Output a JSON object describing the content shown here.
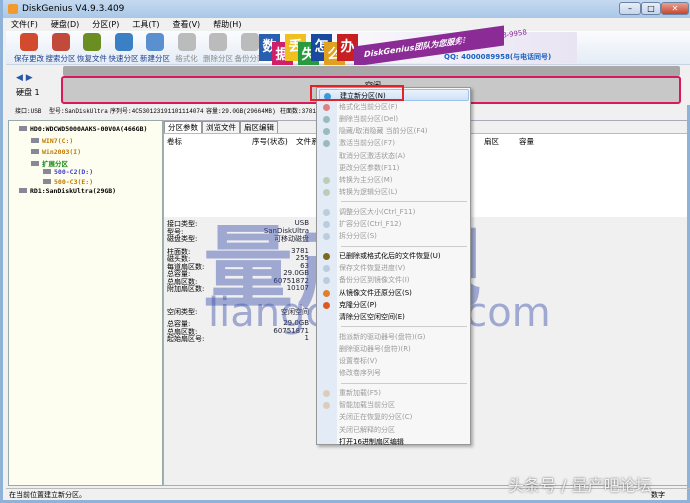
{
  "window": {
    "title": "DiskGenius V4.9.3.409"
  },
  "menubar": [
    "文件(F)",
    "硬盘(D)",
    "分区(P)",
    "工具(T)",
    "查看(V)",
    "帮助(H)"
  ],
  "toolbar": [
    {
      "label": "保存更改",
      "icon": "save-icon",
      "enabled": true,
      "color": "#d24b2e"
    },
    {
      "label": "搜索分区",
      "icon": "search-icon",
      "enabled": true,
      "color": "#c24a3a"
    },
    {
      "label": "恢复文件",
      "icon": "recover-file-icon",
      "enabled": true,
      "color": "#6b8e23"
    },
    {
      "label": "快速分区",
      "icon": "quick-partition-icon",
      "enabled": true,
      "color": "#3b7fc4"
    },
    {
      "label": "新建分区",
      "icon": "new-partition-icon",
      "enabled": true,
      "color": "#5a8fd0"
    },
    {
      "label": "格式化",
      "icon": "format-icon",
      "enabled": false,
      "color": "#bbbbbb"
    },
    {
      "label": "删除分区",
      "icon": "delete-partition-icon",
      "enabled": false,
      "color": "#bbbbbb"
    },
    {
      "label": "备份分区",
      "icon": "backup-partition-icon",
      "enabled": false,
      "color": "#bbbbbb"
    }
  ],
  "banner": {
    "tiles": [
      "数",
      "据",
      "丢",
      "失",
      "怎",
      "么",
      "办"
    ],
    "team": "DiskGenius团队为您服务!",
    "phone": "电话: 400-008-9958",
    "qq": "QQ: 4000089958(与电话同号)"
  },
  "disk_map": {
    "free_label": "空闲",
    "disk_label": "硬盘 1",
    "nav": "◀ ▶"
  },
  "disk_info": {
    "interface": "接口:USB",
    "model": "型号:SanDiskUltra",
    "serial": "序列号:4C530123191101114074",
    "capacity": "容量:29.0GB(29664MB)",
    "cylinders": "柱面数:3781"
  },
  "tree": [
    {
      "label": "HD0:WDCWD5000AAKS-00V0A(466GB)",
      "color": "#000"
    },
    {
      "label": "WIN7(C:)",
      "color": "#c07a00"
    },
    {
      "label": "Win2003(I)",
      "color": "#c07a00"
    },
    {
      "label": "扩展分区",
      "color": "#1a8a1a"
    },
    {
      "label": "500-C2(D:)",
      "color": "#4040d0"
    },
    {
      "label": "500-C3(E:)",
      "color": "#c07a00"
    },
    {
      "label": "RD1:SanDiskUltra(29GB)",
      "color": "#000"
    }
  ],
  "tabs": [
    "分区参数",
    "浏览文件",
    "扇区编辑"
  ],
  "columns": [
    "卷标",
    "序号(状态)",
    "文件系统",
    "扇区",
    "容量"
  ],
  "details": {
    "group1": [
      [
        "接口类型:",
        "USB"
      ],
      [
        "型号:",
        "SanDiskUltra"
      ],
      [
        "磁盘类型:",
        "可移动磁盘"
      ]
    ],
    "group2": [
      [
        "柱面数:",
        "3781"
      ],
      [
        "磁头数:",
        "255"
      ],
      [
        "每道扇区数:",
        "63"
      ],
      [
        "总容量:",
        "29.0GB"
      ],
      [
        "总扇区数:",
        "60751872"
      ],
      [
        "附加扇区数:",
        "10107"
      ]
    ],
    "group3": [
      [
        "空闲类型:",
        "空闲空间"
      ]
    ],
    "group4": [
      [
        "总容量:",
        "29.0GB"
      ],
      [
        "总扇区数:",
        "60751871"
      ],
      [
        "起始扇区号:",
        "1"
      ]
    ]
  },
  "context_menu": [
    {
      "label": "建立新分区(N)",
      "enabled": true,
      "highlighted": true,
      "icon": "new-partition-icon",
      "color": "#3a9ad9"
    },
    {
      "label": "格式化当前分区(F)",
      "enabled": false,
      "icon": "format-icon",
      "color": "#e08080"
    },
    {
      "label": "删除当前分区(Del)",
      "enabled": false,
      "icon": "delete-icon",
      "color": "#9bb"
    },
    {
      "label": "隐藏/取消隐藏 当前分区(F4)",
      "enabled": false,
      "icon": "hide-icon",
      "color": "#9bb"
    },
    {
      "label": "激活当前分区(F7)",
      "enabled": false,
      "icon": "activate-icon",
      "color": "#9bb"
    },
    {
      "label": "取消分区激活状态(A)",
      "enabled": false
    },
    {
      "label": "更改分区参数(F11)",
      "enabled": false
    },
    {
      "label": "转换为主分区(M)",
      "enabled": false,
      "icon": "convert-primary-icon",
      "color": "#bcb"
    },
    {
      "label": "转换为逻辑分区(L)",
      "enabled": false,
      "icon": "convert-logical-icon",
      "color": "#bcb"
    },
    {
      "sep": true
    },
    {
      "label": "调整分区大小(Ctrl_F11)",
      "enabled": false,
      "icon": "resize-icon",
      "color": "#bcd"
    },
    {
      "label": "扩容分区(Ctrl_F12)",
      "enabled": false,
      "icon": "extend-icon",
      "color": "#bcd"
    },
    {
      "label": "拆分分区(S)",
      "enabled": false,
      "icon": "split-icon",
      "color": "#bcd"
    },
    {
      "sep": true
    },
    {
      "label": "已删除或格式化后的文件恢复(U)",
      "enabled": true,
      "icon": "recover-icon",
      "color": "#7a6a20"
    },
    {
      "label": "保存文件恢复进度(V)",
      "enabled": false,
      "icon": "save-progress-icon",
      "color": "#bcd"
    },
    {
      "label": "备份分区到镜像文件(I)",
      "enabled": false,
      "icon": "backup-icon",
      "color": "#bcd"
    },
    {
      "label": "从镜像文件还原分区(S)",
      "enabled": true,
      "icon": "restore-icon",
      "color": "#e0802a"
    },
    {
      "label": "克隆分区(P)",
      "enabled": true,
      "icon": "clone-icon",
      "color": "#e05a20"
    },
    {
      "label": "清除分区空闲空间(E)",
      "enabled": true
    },
    {
      "sep": true
    },
    {
      "label": "指派新的驱动器号(盘符)(G)",
      "enabled": false
    },
    {
      "label": "删除驱动器号(盘符)(R)",
      "enabled": false
    },
    {
      "label": "设置卷标(V)",
      "enabled": false
    },
    {
      "label": "修改卷序列号",
      "enabled": false
    },
    {
      "sep": true
    },
    {
      "label": "重新加载(F5)",
      "enabled": false,
      "icon": "reload-icon",
      "color": "#dcb"
    },
    {
      "label": "智能加载当前分区",
      "enabled": false,
      "icon": "smart-load-icon",
      "color": "#dcb"
    },
    {
      "label": "关闭正在恢复的分区(C)",
      "enabled": false
    },
    {
      "label": "关闭已解释的分区",
      "enabled": false
    },
    {
      "label": "打开16进制扇区编辑",
      "enabled": true
    }
  ],
  "status": {
    "text": "在当前位置建立新分区。",
    "right": "数字"
  },
  "watermark": {
    "big": "量产吧",
    "url": "liangchanba.com",
    "footer": "头条号 / 量产吧论坛"
  }
}
